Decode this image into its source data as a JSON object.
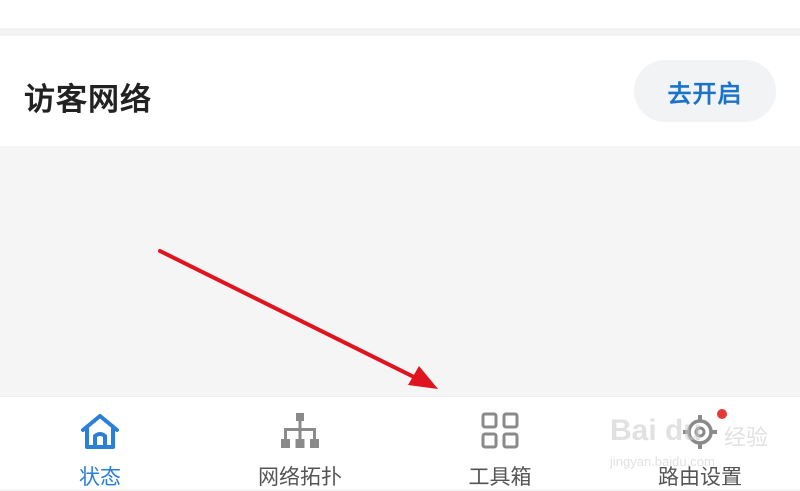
{
  "guest_network": {
    "title": "访客网络",
    "enable_button": "去开启"
  },
  "tabbar": {
    "tabs": [
      {
        "label": "状态",
        "icon": "home-icon",
        "active": true
      },
      {
        "label": "网络拓扑",
        "icon": "network-topology-icon",
        "active": false
      },
      {
        "label": "工具箱",
        "icon": "toolbox-grid-icon",
        "active": false
      },
      {
        "label": "路由设置",
        "icon": "router-settings-gear-icon",
        "active": false,
        "badge": true
      }
    ]
  },
  "annotation": {
    "arrow_color": "#e0141e"
  },
  "watermark": {
    "brand": "Bai du",
    "suffix": "经验",
    "url": "jingyan.baidu.com"
  },
  "colors": {
    "accent": "#2a7fd8",
    "button_text": "#1a73c8",
    "badge": "#e53935"
  }
}
